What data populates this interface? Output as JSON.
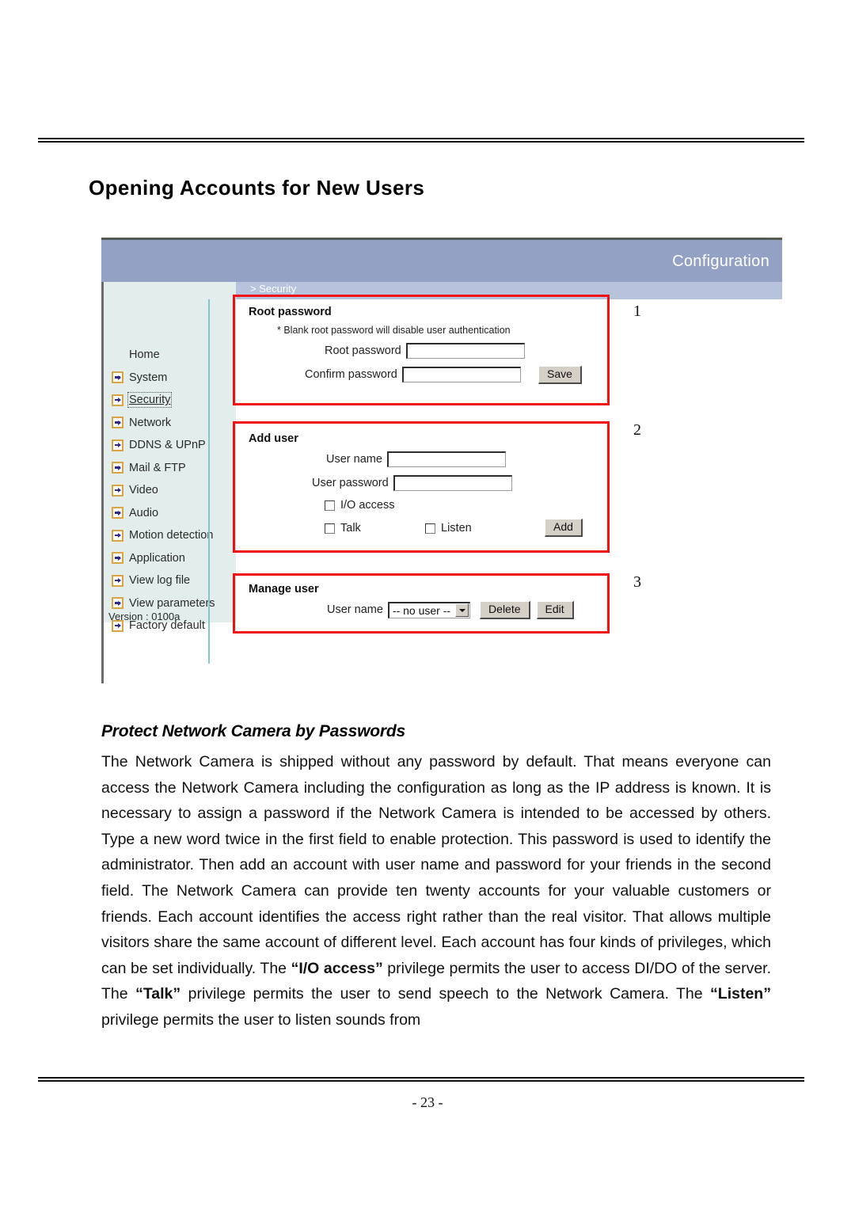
{
  "page": {
    "title": "Opening Accounts for New Users",
    "page_number": "- 23 -"
  },
  "app": {
    "banner_title": "Configuration",
    "breadcrumb": "> Security",
    "version": "Version : 0100a",
    "sidebar": {
      "items": [
        {
          "label": "Home",
          "icon": "none",
          "selected": false
        },
        {
          "label": "System",
          "icon": "arrow-bullet-icon",
          "selected": false
        },
        {
          "label": "Security",
          "icon": "arrow-bullet-icon",
          "selected": true
        },
        {
          "label": "Network",
          "icon": "arrow-bullet-icon",
          "selected": false
        },
        {
          "label": "DDNS & UPnP",
          "icon": "arrow-bullet-icon",
          "selected": false
        },
        {
          "label": "Mail & FTP",
          "icon": "arrow-bullet-icon",
          "selected": false
        },
        {
          "label": "Video",
          "icon": "arrow-bullet-icon",
          "selected": false
        },
        {
          "label": "Audio",
          "icon": "arrow-bullet-icon",
          "selected": false
        },
        {
          "label": "Motion detection",
          "icon": "arrow-bullet-icon",
          "selected": false
        },
        {
          "label": "Application",
          "icon": "arrow-bullet-icon",
          "selected": false
        },
        {
          "label": "View log file",
          "icon": "arrow-bullet-icon",
          "selected": false
        },
        {
          "label": "View parameters",
          "icon": "arrow-bullet-icon",
          "selected": false
        },
        {
          "label": "Factory default",
          "icon": "arrow-bullet-icon",
          "selected": false
        }
      ]
    },
    "root_password": {
      "title": "Root password",
      "hint": "* Blank root password will disable user authentication",
      "root_label": "Root password",
      "root_value": "",
      "confirm_label": "Confirm password",
      "confirm_value": "",
      "save_label": "Save",
      "callout": "1"
    },
    "add_user": {
      "title": "Add user",
      "username_label": "User name",
      "username_value": "",
      "password_label": "User password",
      "password_value": "",
      "io_access_label": "I/O access",
      "talk_label": "Talk",
      "listen_label": "Listen",
      "add_label": "Add",
      "callout": "2"
    },
    "manage_user": {
      "title": "Manage user",
      "username_label": "User name",
      "selected_user": "-- no user --",
      "delete_label": "Delete",
      "edit_label": "Edit",
      "callout": "3"
    },
    "colors": {
      "banner": "#93a1c4",
      "subbanner": "#b7c2dc",
      "sidebar": "#e2edec",
      "annotation": "#ee1111",
      "rail": "#7fc8cd"
    }
  },
  "prose": {
    "heading": "Protect Network Camera by Passwords",
    "p1_a": "The Network Camera is shipped without any password by default. That means everyone can access the Network Camera including the configuration as long as the IP address is known. It is necessary to assign a password if the Network Camera is intended to be accessed by others. Type a new word twice in the first field to enable protection. This password is used to identify the administrator. Then add an account with user name and password for your friends in the second field. The Network Camera can provide ten twenty accounts for your valuable customers or friends. Each account identifies the access right rather than the real visitor. That allows multiple visitors share the same account of different level. Each account has four kinds of privileges, which can be set individually. The ",
    "b1": "“I/O access”",
    "p1_b": " privilege permits the user to access DI/DO of the server. The ",
    "b2": "“Talk”",
    "p1_c": " privilege permits the user to send speech to the Network Camera. The ",
    "b3": "“Listen”",
    "p1_d": " privilege permits the user to listen sounds from"
  }
}
